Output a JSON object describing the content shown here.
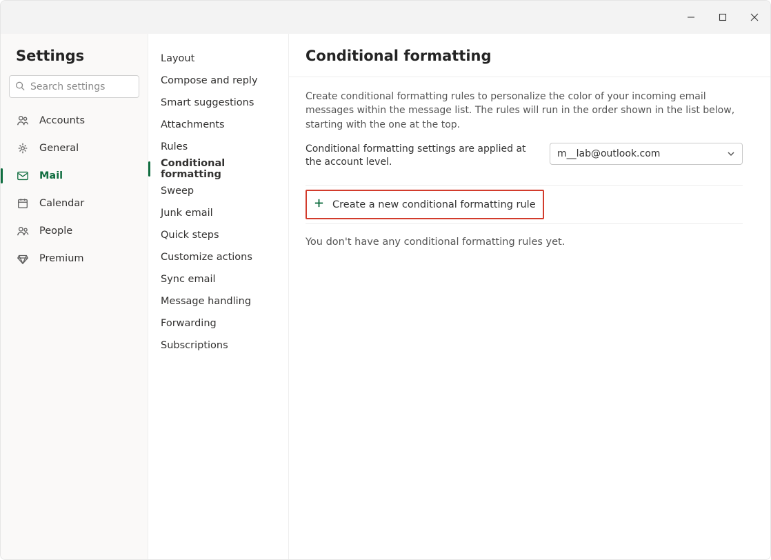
{
  "titlebar": {
    "minimize": "Minimize",
    "maximize": "Maximize",
    "close": "Close"
  },
  "sidebar": {
    "title": "Settings",
    "search_placeholder": "Search settings",
    "items": [
      {
        "label": "Accounts"
      },
      {
        "label": "General"
      },
      {
        "label": "Mail"
      },
      {
        "label": "Calendar"
      },
      {
        "label": "People"
      },
      {
        "label": "Premium"
      }
    ]
  },
  "subnav": {
    "items": [
      {
        "label": "Layout"
      },
      {
        "label": "Compose and reply"
      },
      {
        "label": "Smart suggestions"
      },
      {
        "label": "Attachments"
      },
      {
        "label": "Rules"
      },
      {
        "label": "Conditional formatting"
      },
      {
        "label": "Sweep"
      },
      {
        "label": "Junk email"
      },
      {
        "label": "Quick steps"
      },
      {
        "label": "Customize actions"
      },
      {
        "label": "Sync email"
      },
      {
        "label": "Message handling"
      },
      {
        "label": "Forwarding"
      },
      {
        "label": "Subscriptions"
      }
    ]
  },
  "main": {
    "title": "Conditional formatting",
    "description": "Create conditional formatting rules to personalize the color of your incoming email messages within the message list. The rules will run in the order shown in the list below, starting with the one at the top.",
    "account_label": "Conditional formatting settings are applied at the account level.",
    "account_value": "m__lab@outlook.com",
    "create_label": "Create a new conditional formatting rule",
    "empty_text": "You don't have any conditional formatting rules yet."
  }
}
